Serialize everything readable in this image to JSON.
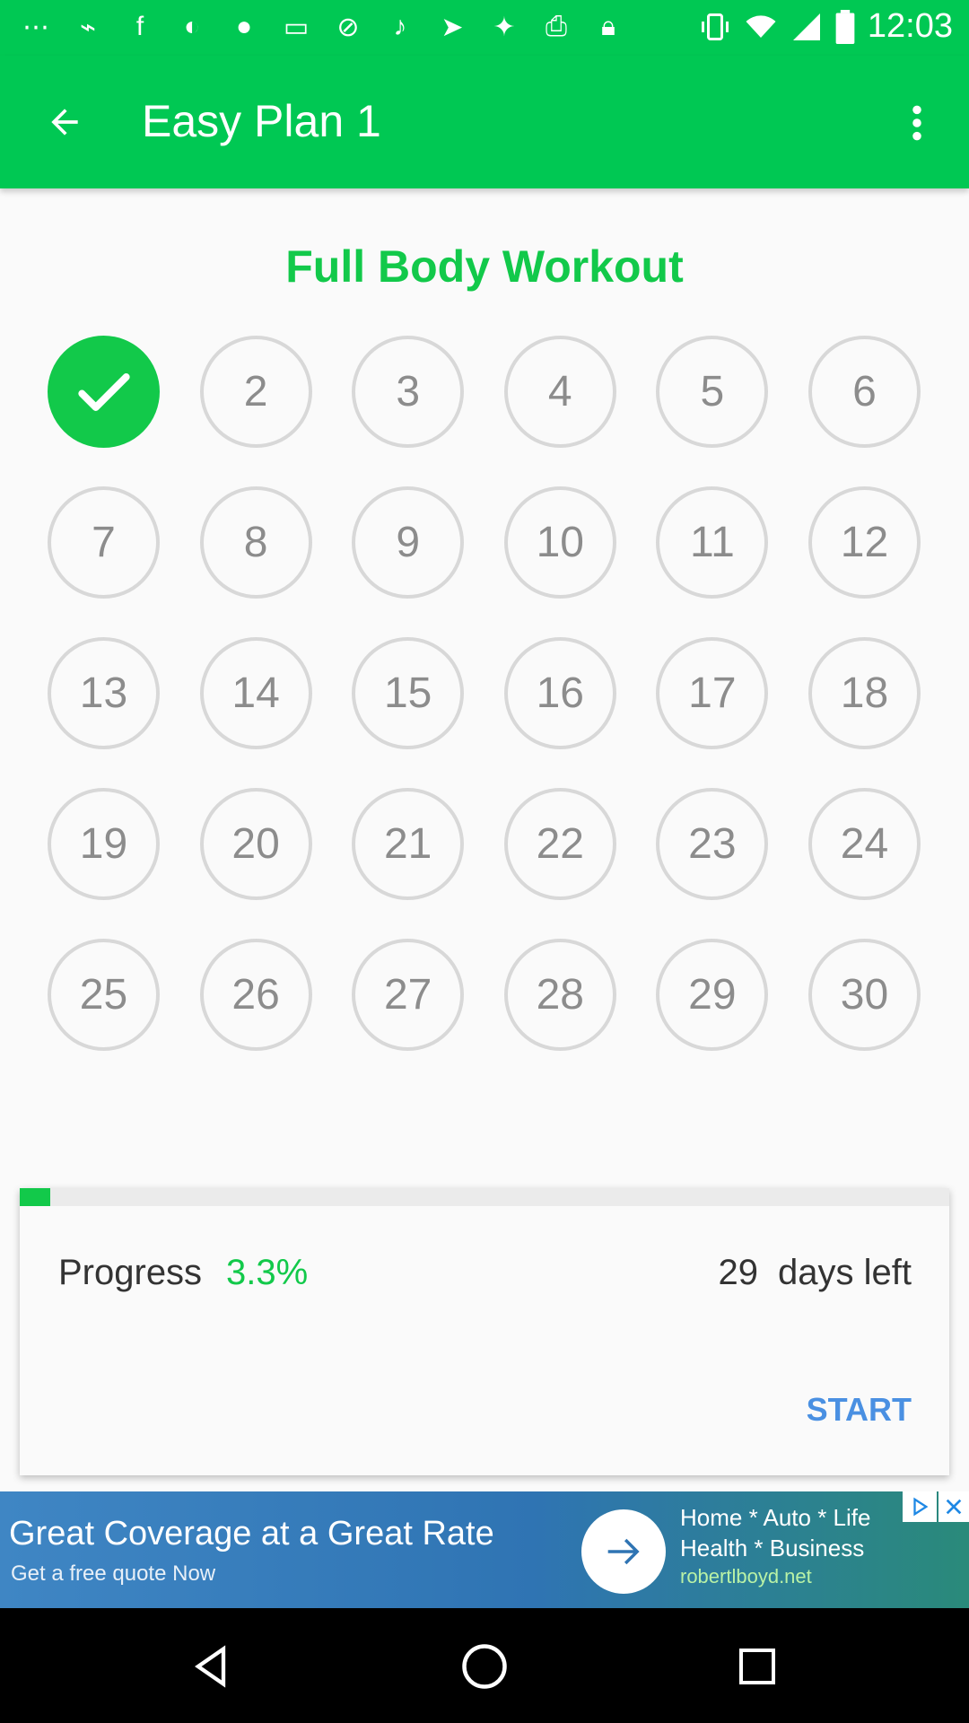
{
  "status_bar": {
    "time": "12:03",
    "left_icons": [
      "more-dots-icon",
      "usb-icon",
      "facebook-icon",
      "moon-icon",
      "usa-today-icon",
      "cassette-icon",
      "no-signal-icon",
      "guitar-icon",
      "send-icon",
      "satellite-icon",
      "printer-icon",
      "lock-icon"
    ],
    "right_icons": [
      "vibrate-icon",
      "wifi-icon",
      "cell-signal-icon",
      "battery-icon"
    ]
  },
  "app_bar": {
    "title": "Easy Plan 1",
    "back_icon": "arrow-back-icon",
    "menu_icon": "more-vert-icon"
  },
  "workout": {
    "title": "Full Body Workout",
    "completed_days": [
      1
    ],
    "days": [
      "1",
      "2",
      "3",
      "4",
      "5",
      "6",
      "7",
      "8",
      "9",
      "10",
      "11",
      "12",
      "13",
      "14",
      "15",
      "16",
      "17",
      "18",
      "19",
      "20",
      "21",
      "22",
      "23",
      "24",
      "25",
      "26",
      "27",
      "28",
      "29",
      "30"
    ]
  },
  "progress": {
    "label": "Progress",
    "value": "3.3%",
    "fraction": 0.033,
    "days_left_count": "29",
    "days_left_label": "days left",
    "start_label": "START"
  },
  "ad": {
    "headline": "Great Coverage at a Great Rate",
    "subline": "Get a free quote Now",
    "line1": "Home * Auto * Life",
    "line2": "Health * Business",
    "url": "robertlboyd.net"
  },
  "colors": {
    "primary_green": "#00c853",
    "accent_green": "#12c94a",
    "start_blue": "#4a90e2",
    "circle_border": "#d8d8d8"
  }
}
